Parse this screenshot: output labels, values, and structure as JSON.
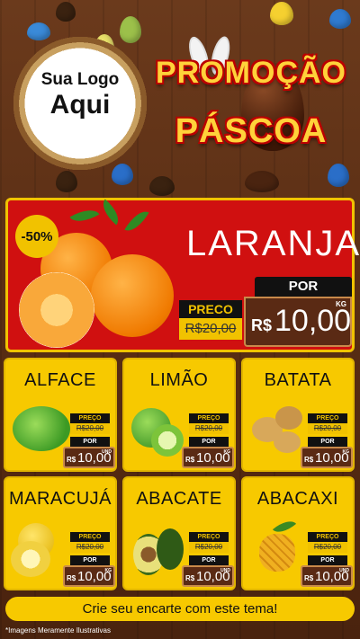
{
  "header": {
    "logo_line1": "Sua Logo",
    "logo_line2": "Aqui",
    "promo_line1": "PROMOÇÃO",
    "promo_line2": "PÁSCOA"
  },
  "hero": {
    "name": "LARANJA",
    "discount_badge": "-50%",
    "preco_label": "PRECO",
    "old_price": "R$20,00",
    "por_label": "POR",
    "currency": "R$",
    "new_price": "10,00",
    "unit": "KG"
  },
  "products": [
    {
      "name": "ALFACE",
      "preco_label": "PREÇO",
      "old_price": "R$20,00",
      "por_label": "POR",
      "currency": "R$",
      "new_price": "10,00",
      "unit": "UND"
    },
    {
      "name": "LIMÃO",
      "preco_label": "PREÇO",
      "old_price": "R$20,00",
      "por_label": "POR",
      "currency": "R$",
      "new_price": "10,00",
      "unit": "KG"
    },
    {
      "name": "BATATA",
      "preco_label": "PREÇO",
      "old_price": "R$20,00",
      "por_label": "POR",
      "currency": "R$",
      "new_price": "10,00",
      "unit": "KG"
    },
    {
      "name": "MARACUJÁ",
      "preco_label": "PREÇO",
      "old_price": "R$20,00",
      "por_label": "POR",
      "currency": "R$",
      "new_price": "10,00",
      "unit": "KG"
    },
    {
      "name": "ABACATE",
      "preco_label": "PREÇO",
      "old_price": "R$20,00",
      "por_label": "POR",
      "currency": "R$",
      "new_price": "10,00",
      "unit": "UND"
    },
    {
      "name": "ABACAXI",
      "preco_label": "PREÇO",
      "old_price": "R$20,00",
      "por_label": "POR",
      "currency": "R$",
      "new_price": "10,00",
      "unit": "UND"
    }
  ],
  "footer": {
    "cta": "Crie seu encarte com este tema!",
    "disclaimer": "*Imagens Meramente Ilustrativas"
  },
  "colors": {
    "background_wood": "#5a2e14",
    "hero_red": "#d01010",
    "card_yellow": "#f7c900",
    "label_black": "#111111",
    "price_brown": "#5a2a14",
    "promo_gold": "#ffd23a"
  }
}
